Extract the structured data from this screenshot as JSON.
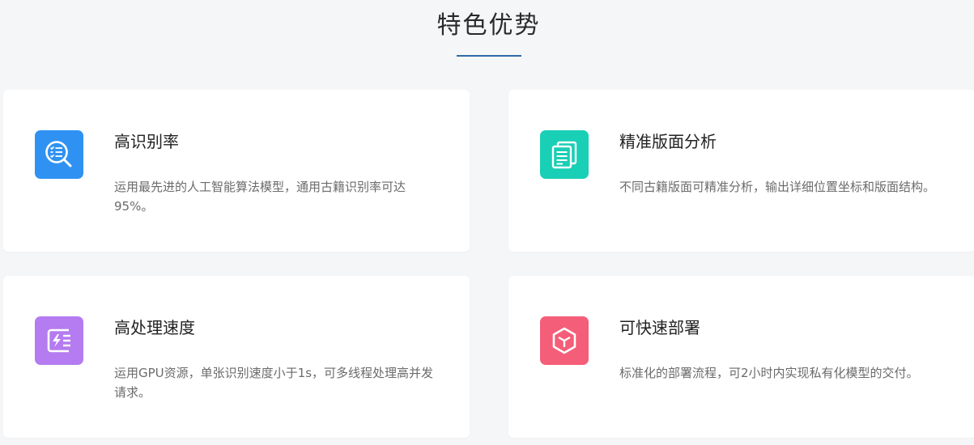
{
  "section": {
    "title": "特色优势"
  },
  "colors": {
    "accent_underline": "#2f6aa8",
    "icon_blue": "#2f92f2",
    "icon_teal": "#19cfb5",
    "icon_purple": "#b47cf0",
    "icon_red": "#f45e78"
  },
  "features": [
    {
      "icon": "search-list-icon",
      "title": "高识别率",
      "desc": "运用最先进的人工智能算法模型，通用古籍识别率可达95%。"
    },
    {
      "icon": "document-layers-icon",
      "title": "精准版面分析",
      "desc": "不同古籍版面可精准分析，输出详细位置坐标和版面结构。"
    },
    {
      "icon": "speed-lightning-icon",
      "title": "高处理速度",
      "desc": "运用GPU资源，单张识别速度小于1s，可多线程处理高并发请求。"
    },
    {
      "icon": "cube-icon",
      "title": "可快速部署",
      "desc": "标准化的部署流程，可2小时内实现私有化模型的交付。"
    }
  ]
}
